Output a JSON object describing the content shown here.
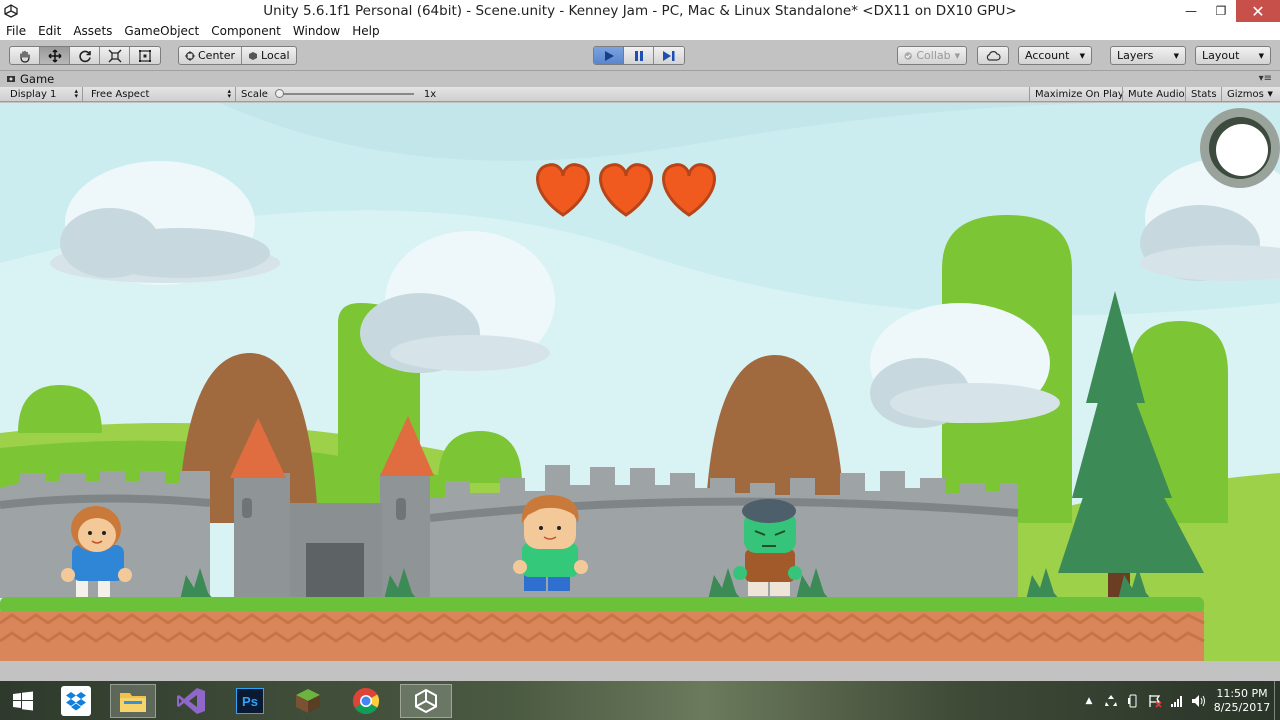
{
  "window": {
    "title": "Unity 5.6.1f1 Personal (64bit) - Scene.unity - Kenney Jam - PC, Mac & Linux Standalone* <DX11 on DX10 GPU>",
    "minimize": "—",
    "maximize": "❐",
    "close": "✕"
  },
  "menu": [
    "File",
    "Edit",
    "Assets",
    "GameObject",
    "Component",
    "Window",
    "Help"
  ],
  "toolbar": {
    "tools": [
      "hand-icon",
      "move-icon",
      "rotate-icon",
      "scale-icon",
      "rect-icon"
    ],
    "pivot": {
      "center": "Center",
      "local": "Local"
    },
    "playback": [
      "play-icon",
      "pause-icon",
      "step-icon"
    ],
    "collab": "Collab",
    "account": "Account",
    "layers": "Layers",
    "layout": "Layout"
  },
  "game_view": {
    "tab_label": "Game",
    "display": "Display 1",
    "aspect": "Free Aspect",
    "scale_label": "Scale",
    "scale_value": "1x",
    "maximize_on_play": "Maximize On Play",
    "mute_audio": "Mute Audio",
    "stats": "Stats",
    "gizmos": "Gizmos"
  },
  "game": {
    "hearts": 3,
    "colors": {
      "sky": "#d9f3f5",
      "grass": "#6cc13b",
      "dirt": "#d9865a",
      "wall": "#9ea3a5",
      "heart": "#f05a1e"
    }
  },
  "taskbar": {
    "apps": [
      "windows-start-icon",
      "dropbox-icon",
      "file-explorer-icon",
      "visual-studio-icon",
      "photoshop-icon",
      "minecraft-icon",
      "chrome-icon",
      "unity-icon"
    ],
    "photoshop_label": "Ps",
    "time": "11:50 PM",
    "date": "8/25/2017"
  }
}
